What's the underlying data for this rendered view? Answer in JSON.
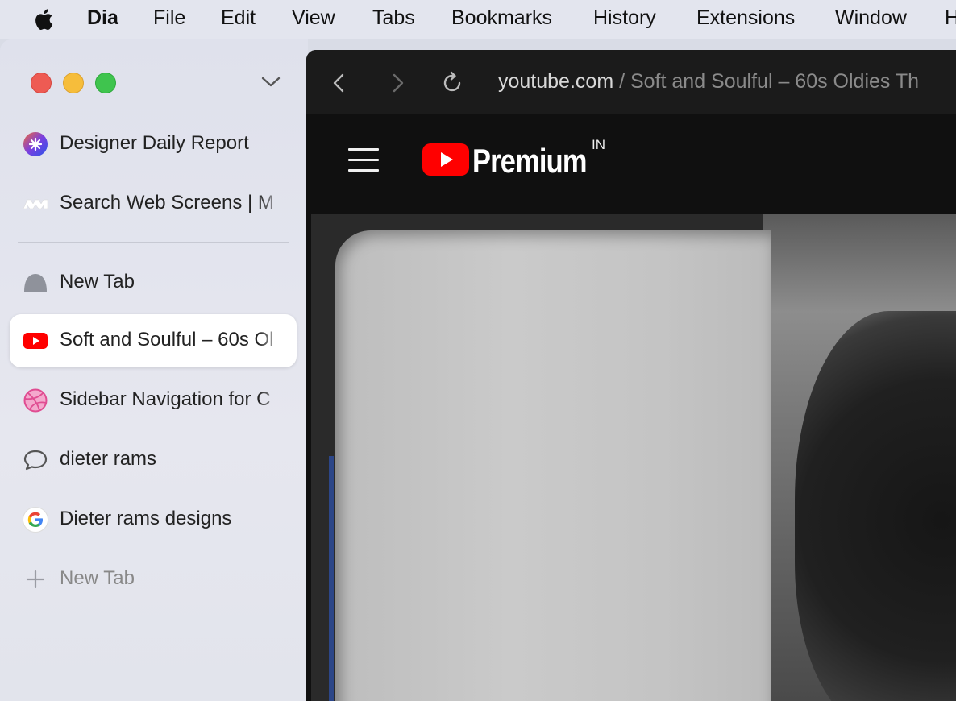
{
  "menubar": {
    "app_name": "Dia",
    "items": [
      "File",
      "Edit",
      "View",
      "Tabs",
      "Bookmarks",
      "History",
      "Extensions",
      "Window",
      "H"
    ]
  },
  "sidebar": {
    "pinned": [
      {
        "label": "Designer Daily Report",
        "icon": "designer-daily-icon"
      },
      {
        "label": "Search Web Screens | M",
        "icon": "mobbin-icon"
      }
    ],
    "tabs": [
      {
        "label": "New Tab",
        "icon": "blank-tab-icon"
      },
      {
        "label": "Soft and Soulful – 60s Ol",
        "icon": "youtube-icon",
        "active": true
      },
      {
        "label": "Sidebar Navigation for C",
        "icon": "dribbble-icon"
      },
      {
        "label": "dieter rams",
        "icon": "chat-bubble-icon"
      },
      {
        "label": "Dieter rams designs",
        "icon": "google-icon"
      }
    ],
    "new_tab_label": "New Tab"
  },
  "browser": {
    "url_host": "youtube.com",
    "url_rest": " / Soft and Soulful – 60s Oldies Th"
  },
  "youtube": {
    "brand": "Premium",
    "region": "IN"
  },
  "colors": {
    "youtube_red": "#ff0000",
    "sidebar_bg": "#e2e4ec",
    "browser_bg": "#101010"
  }
}
